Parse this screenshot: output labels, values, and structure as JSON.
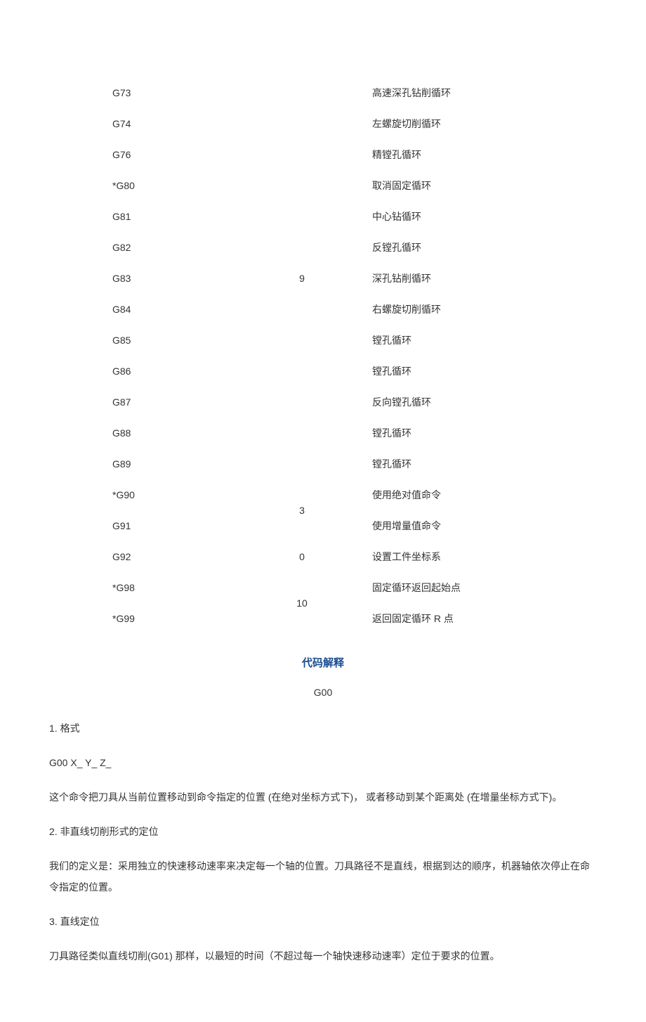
{
  "table": {
    "group9": {
      "group_value": "9",
      "rows": [
        {
          "code": "G73",
          "desc": "高速深孔钻削循环"
        },
        {
          "code": "G74",
          "desc": "左螺旋切削循环"
        },
        {
          "code": "G76",
          "desc": "精镗孔循环"
        },
        {
          "code": "*G80",
          "desc": "取消固定循环"
        },
        {
          "code": "G81",
          "desc": "中心钻循环"
        },
        {
          "code": "G82",
          "desc": "反镗孔循环"
        },
        {
          "code": "G83",
          "desc": "深孔钻削循环"
        },
        {
          "code": "G84",
          "desc": "右螺旋切削循环"
        },
        {
          "code": "G85",
          "desc": "镗孔循环"
        },
        {
          "code": "G86",
          "desc": "镗孔循环"
        },
        {
          "code": "G87",
          "desc": "反向镗孔循环"
        },
        {
          "code": "G88",
          "desc": "镗孔循环"
        },
        {
          "code": "G89",
          "desc": "镗孔循环"
        }
      ]
    },
    "group3": {
      "group_value": "3",
      "rows": [
        {
          "code": "*G90",
          "desc": "使用绝对值命令"
        },
        {
          "code": "G91",
          "desc": "使用增量值命令"
        }
      ]
    },
    "group0": {
      "group_value": "0",
      "rows": [
        {
          "code": "G92",
          "desc": "设置工件坐标系"
        }
      ]
    },
    "group10": {
      "group_value": "10",
      "rows": [
        {
          "code": "*G98",
          "desc": "固定循环返回起始点"
        },
        {
          "code": "*G99",
          "desc": "返回固定循环 R 点"
        }
      ]
    }
  },
  "section_title": "代码解释",
  "sub_title": "G00",
  "paragraphs": {
    "p1": "1. 格式",
    "p2": "G00 X_ Y_ Z_",
    "p3": "这个命令把刀具从当前位置移动到命令指定的位置 (在绝对坐标方式下)， 或者移动到某个距离处 (在增量坐标方式下)。",
    "p4": "2. 非直线切削形式的定位",
    "p5": "我们的定义是：采用独立的快速移动速率来决定每一个轴的位置。刀具路径不是直线，根据到达的顺序，机器轴依次停止在命令指定的位置。",
    "p6": "3. 直线定位",
    "p7": "刀具路径类似直线切削(G01) 那样，以最短的时间（不超过每一个轴快速移动速率）定位于要求的位置。"
  }
}
